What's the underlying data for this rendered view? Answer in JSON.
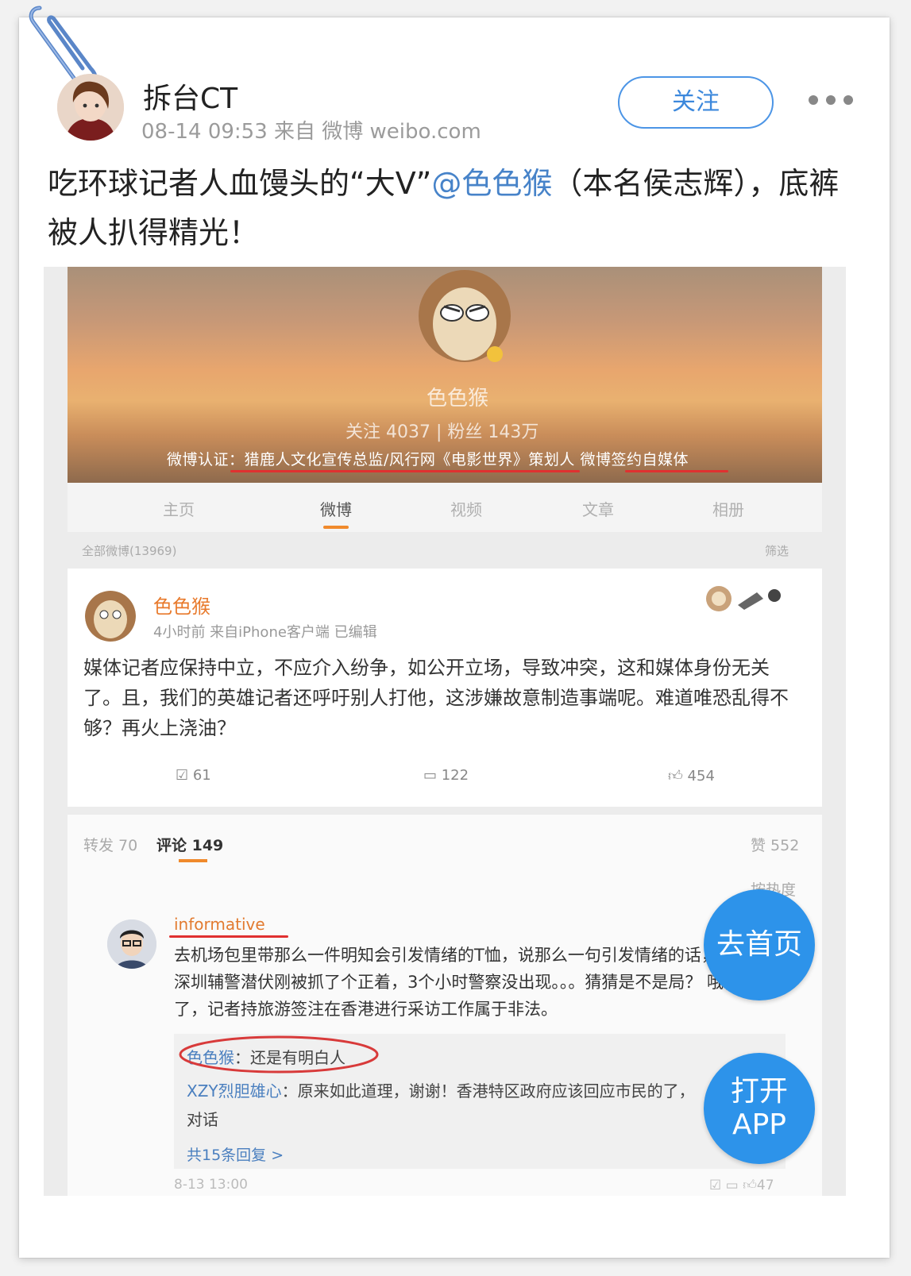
{
  "header": {
    "user_name": "拆台CT",
    "meta": "08-14 09:53 来自 微博 weibo.com",
    "follow_label": "关注"
  },
  "post": {
    "text_before": "吃环球记者人血馒头的“大V”",
    "mention": "@色色猴",
    "text_after": "（本名侯志辉），底裤被人扒得精光！"
  },
  "photo": {
    "profile": {
      "name": "色色猴",
      "stats": "关注 4037  |  粉丝 143万",
      "verification": "微博认证：猎鹿人文化宣传总监/风行网《电影世界》策划人 微博签约自媒体"
    },
    "tabs": [
      "主页",
      "微博",
      "视频",
      "文章",
      "相册"
    ],
    "active_tab": "微博",
    "all_posts": "全部微博(13969)",
    "filter": "筛选",
    "weibo": {
      "author": "色色猴",
      "meta": "4小时前 来自iPhone客户端 已编辑",
      "text": "媒体记者应保持中立，不应介入纷争，如公开立场，导致冲突，这和媒体身份无关了。且，我们的英雄记者还呼吁别人打他，这涉嫌故意制造事端呢。难道唯恐乱得不够？再火上浇油？",
      "repost": "61",
      "comment": "122",
      "like": "454"
    },
    "comments": {
      "tab_repost": "转发 70",
      "tab_comment": "评论 149",
      "likes": "赞 552",
      "sort": "按热度",
      "commenter": "informative",
      "comment_text": "去机场包里带那么一件明知会引发情绪的T恤，说那么一句引发情绪的话，一个深圳辅警潜伏刚被抓了个正着，3个小时警察没出现。。。猜猜是不是局？ 哦，对了，记者持旅游签注在香港进行采访工作属于非法。",
      "reply1_name": "色色猴",
      "reply1_text": "：还是有明白人",
      "reply2_name": "XZY烈胆雄心",
      "reply2_text": "：原来如此道理，谢谢！香港特区政府应该回应市民的了，",
      "reply2_line2": "对话",
      "more_replies": "共15条回复 >",
      "date": "8-13 13:00",
      "footer_like": "47"
    }
  },
  "floating": {
    "home_label": "去首页",
    "open_line1": "打开",
    "open_line2": "APP"
  },
  "colors": {
    "accent": "#3c88dc",
    "float_btn": "#2d93ea",
    "mention": "#4783c9",
    "weibo_orange": "#e87a2c",
    "underline_red": "#e03030"
  }
}
